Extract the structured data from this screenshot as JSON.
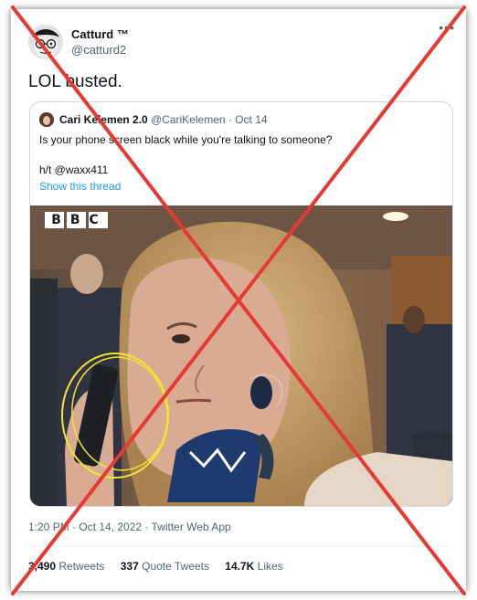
{
  "tweet": {
    "author_name": "Catturd ™",
    "author_handle": "@catturd2",
    "more_icon": "more-dots-icon",
    "text": "LOL busted.",
    "timestamp": "1:20 PM · Oct 14, 2022 · Twitter Web App",
    "stats": {
      "retweets_count": "3,490",
      "retweets_label": "Retweets",
      "quotes_count": "337",
      "quotes_label": "Quote Tweets",
      "likes_count": "14.7K",
      "likes_label": "Likes"
    }
  },
  "quoted_tweet": {
    "author_name": "Cari Kelemen 2.0",
    "author_handle_date": "@CariKelemen · Oct 14",
    "text": "Is your phone screen black while you're talking to someone?",
    "hat_tip": "h/t @waxx411",
    "show_thread": "Show this thread",
    "media": {
      "watermark": "BBC"
    }
  },
  "overlay": {
    "cross_color": "#e53935"
  },
  "colors": {
    "link": "#1d9bf0",
    "secondary_text": "#536471",
    "primary_text": "#0f1419",
    "annotation_circle": "#f2e531"
  }
}
